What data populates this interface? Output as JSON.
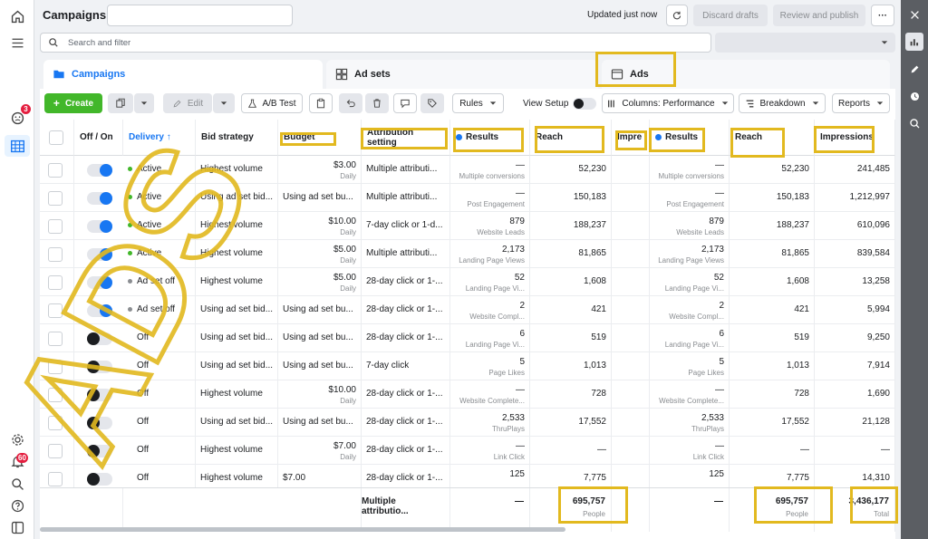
{
  "topbar": {
    "title": "Campaigns",
    "updated": "Updated just now",
    "discard": "Discard drafts",
    "review": "Review and publish",
    "more": "···"
  },
  "search": {
    "placeholder": "Search and filter"
  },
  "tabs": [
    {
      "label": "Campaigns"
    },
    {
      "label": "Ad sets"
    },
    {
      "label": "Ads"
    }
  ],
  "toolbar": {
    "create": "Create",
    "edit": "Edit",
    "ab_test": "A/B Test",
    "rules": "Rules",
    "view_setup": "View Setup",
    "columns": "Columns: Performance",
    "breakdown": "Breakdown",
    "reports": "Reports"
  },
  "nav_badges": {
    "alerts": "3",
    "notifications": "60"
  },
  "headers": {
    "off_on": "Off / On",
    "delivery": "Delivery ↑",
    "bid_strategy": "Bid strategy",
    "budget": "Budget",
    "attribution": "Attribution setting",
    "results": "Results",
    "reach": "Reach",
    "impre": "Impre",
    "results2": "Results",
    "reach2": "Reach",
    "impressions": "Impressions"
  },
  "rows": [
    {
      "on": true,
      "delivery": "Active",
      "dstatus": "active",
      "bid": "Highest volume",
      "budget": "$3.00",
      "budget_sub": "Daily",
      "attr": "Multiple attributi...",
      "results": "—",
      "results_sub": "Multiple conversions",
      "reach": "52,230",
      "results2": "—",
      "results2_sub": "Multiple conversions",
      "reach2": "52,230",
      "impressions": "241,485"
    },
    {
      "on": true,
      "delivery": "Active",
      "dstatus": "active",
      "bid": "Using ad set bid...",
      "budget": "Using ad set bu...",
      "budget_sub": "",
      "attr": "Multiple attributi...",
      "results": "—",
      "results_sub": "Post Engagement",
      "reach": "150,183",
      "results2": "—",
      "results2_sub": "Post Engagement",
      "reach2": "150,183",
      "impressions": "1,212,997"
    },
    {
      "on": true,
      "delivery": "Active",
      "dstatus": "active",
      "bid": "Highest volume",
      "budget": "$10.00",
      "budget_sub": "Daily",
      "attr": "7-day click or 1-d...",
      "results": "879",
      "results_sub": "Website Leads",
      "reach": "188,237",
      "results2": "879",
      "results2_sub": "Website Leads",
      "reach2": "188,237",
      "impressions": "610,096"
    },
    {
      "on": true,
      "delivery": "Active",
      "dstatus": "active",
      "bid": "Highest volume",
      "budget": "$5.00",
      "budget_sub": "Daily",
      "attr": "Multiple attributi...",
      "results": "2,173",
      "results_sub": "Landing Page Views",
      "reach": "81,865",
      "results2": "2,173",
      "results2_sub": "Landing Page Views",
      "reach2": "81,865",
      "impressions": "839,584"
    },
    {
      "on": true,
      "delivery": "Ad set off",
      "dstatus": "off",
      "bid": "Highest volume",
      "budget": "$5.00",
      "budget_sub": "Daily",
      "attr": "28-day click or 1-...",
      "results": "52",
      "results_sub": "Landing Page Vi...",
      "reach": "1,608",
      "results2": "52",
      "results2_sub": "Landing Page Vi...",
      "reach2": "1,608",
      "impressions": "13,258"
    },
    {
      "on": true,
      "delivery": "Ad set off",
      "dstatus": "off",
      "bid": "Using ad set bid...",
      "budget": "Using ad set bu...",
      "budget_sub": "",
      "attr": "28-day click or 1-...",
      "results": "2",
      "results_sub": "Website Compl...",
      "reach": "421",
      "results2": "2",
      "results2_sub": "Website Compl...",
      "reach2": "421",
      "impressions": "5,994"
    },
    {
      "on": false,
      "delivery": "Off",
      "dstatus": "none",
      "bid": "Using ad set bid...",
      "budget": "Using ad set bu...",
      "budget_sub": "",
      "attr": "28-day click or 1-...",
      "results": "6",
      "results_sub": "Landing Page Vi...",
      "reach": "519",
      "results2": "6",
      "results2_sub": "Landing Page Vi...",
      "reach2": "519",
      "impressions": "9,250"
    },
    {
      "on": false,
      "delivery": "Off",
      "dstatus": "none",
      "bid": "Using ad set bid...",
      "budget": "Using ad set bu...",
      "budget_sub": "",
      "attr": "7-day click",
      "results": "5",
      "results_sub": "Page Likes",
      "reach": "1,013",
      "results2": "5",
      "results2_sub": "Page Likes",
      "reach2": "1,013",
      "impressions": "7,914"
    },
    {
      "on": false,
      "delivery": "Off",
      "dstatus": "none",
      "bid": "Highest volume",
      "budget": "$10.00",
      "budget_sub": "Daily",
      "attr": "28-day click or 1-...",
      "results": "—",
      "results_sub": "Website Complete...",
      "reach": "728",
      "results2": "—",
      "results2_sub": "Website Complete...",
      "reach2": "728",
      "impressions": "1,690"
    },
    {
      "on": false,
      "delivery": "Off",
      "dstatus": "none",
      "bid": "Using ad set bid...",
      "budget": "Using ad set bu...",
      "budget_sub": "",
      "attr": "28-day click or 1-...",
      "results": "2,533",
      "results_sub": "ThruPlays",
      "reach": "17,552",
      "results2": "2,533",
      "results2_sub": "ThruPlays",
      "reach2": "17,552",
      "impressions": "21,128"
    },
    {
      "on": false,
      "delivery": "Off",
      "dstatus": "none",
      "bid": "Highest volume",
      "budget": "$7.00",
      "budget_sub": "Daily",
      "attr": "28-day click or 1-...",
      "results": "—",
      "results_sub": "Link Click",
      "reach": "—",
      "results2": "—",
      "results2_sub": "Link Click",
      "reach2": "—",
      "impressions": "—"
    },
    {
      "on": false,
      "delivery": "Off",
      "dstatus": "none",
      "bid": "Highest volume",
      "budget": "$7.00",
      "budget_sub": "",
      "attr": "28-day click or 1-...",
      "results": "125",
      "results_sub": "",
      "reach": "7,775",
      "results2": "125",
      "results2_sub": "",
      "reach2": "7,775",
      "impressions": "14,310"
    }
  ],
  "totals": {
    "attr": "Multiple attributio...",
    "results": "—",
    "reach": "695,757",
    "reach_sub": "People",
    "results2": "—",
    "reach2": "695,757",
    "reach2_sub": "People",
    "impressions": "3,436,177",
    "impressions_sub": "Total"
  },
  "watermark": "ADS",
  "colors": {
    "accent": "#1877f2",
    "green": "#42b72a",
    "highlight": "#e2b91f",
    "active_dot": "#42b72a"
  }
}
